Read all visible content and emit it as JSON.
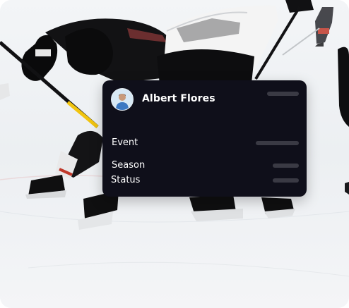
{
  "profile_card": {
    "name": "Albert Flores",
    "fields": [
      {
        "label": "Event"
      },
      {
        "label": "Season"
      },
      {
        "label": "Status"
      }
    ]
  },
  "colors": {
    "card_background": "#0f0f1a",
    "placeholder_bar": "#3a3a44",
    "card_text": "#ffffff"
  }
}
